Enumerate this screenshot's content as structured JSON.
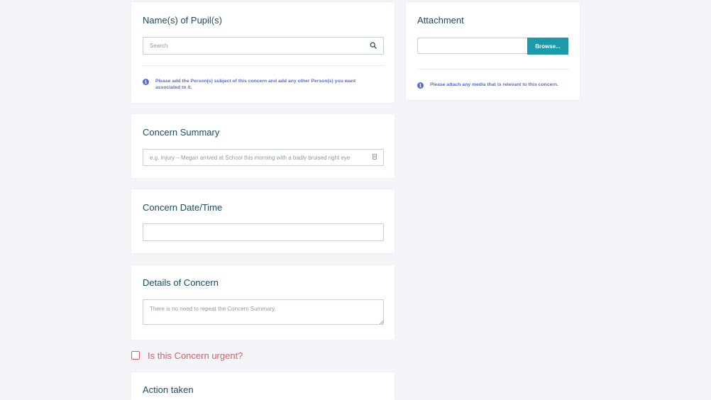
{
  "pupils": {
    "title": "Name(s) of Pupil(s)",
    "search_placeholder": "Search",
    "search_icon": "search-icon",
    "info_text": "Please add the Person(s) subject of this concern and add any other Person(s) you want associated to it."
  },
  "attachment": {
    "title": "Attachment",
    "browse_label": "Browse...",
    "info_text": "Please attach any media that is relevant to this concern."
  },
  "summary": {
    "title": "Concern Summary",
    "placeholder": "e.g. Injury – Megan arrived at School this morning with a badly bruised right eye"
  },
  "datetime": {
    "title": "Concern Date/Time",
    "value": ""
  },
  "details": {
    "title": "Details of Concern",
    "placeholder": "There is no need to repeat the Concern Summary."
  },
  "urgent": {
    "label": "Is this Concern urgent?",
    "checked": false
  },
  "action": {
    "title": "Action taken"
  },
  "colors": {
    "accent": "#1b9aaa",
    "info": "#5b6bd1",
    "urgent": "#e05a6a",
    "heading": "#1f4a5c"
  }
}
